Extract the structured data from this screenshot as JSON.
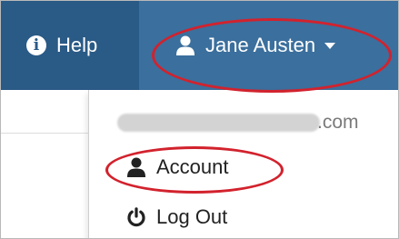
{
  "navbar": {
    "help_label": "Help",
    "help_icon": "info-circle-icon",
    "user_name": "Jane Austen",
    "user_icon": "user-icon",
    "caret_icon": "caret-down-icon",
    "bar_color": "#2a5a86",
    "active_color": "#3b6f9d"
  },
  "dropdown": {
    "email_suffix": ".com",
    "items": [
      {
        "label": "Account",
        "icon": "user-icon"
      },
      {
        "label": "Log Out",
        "icon": "power-icon"
      }
    ]
  },
  "annotations": {
    "color": "#d2222d",
    "highlighted": [
      "user-menu-toggle",
      "account-item"
    ]
  }
}
